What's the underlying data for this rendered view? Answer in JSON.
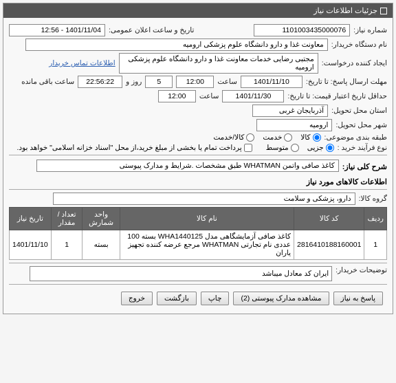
{
  "panel": {
    "title": "جزئیات اطلاعات نیاز"
  },
  "fields": {
    "need_number_label": "شماره نیاز:",
    "need_number": "1101003435000076",
    "announce_label": "تاریخ و ساعت اعلان عمومی:",
    "announce_value": "1401/11/04 - 12:56",
    "buyer_label": "نام دستگاه خریدار:",
    "buyer_value": "معاونت غذا و دارو دانشگاه علوم پزشکی ارومیه",
    "creator_label": "ایجاد کننده درخواست:",
    "creator_value": "مجتبی رضایی خدمات معاونت غذا و دارو دانشگاه علوم پزشکی ارومیه",
    "contact_link": "اطلاعات تماس خریدار",
    "deadline_label": "مهلت ارسال پاسخ: تا تاریخ:",
    "deadline_date": "1401/11/10",
    "hour_label": "ساعت",
    "deadline_time": "12:00",
    "day_label": "روز و",
    "remaining_days": "5",
    "remaining_time": "22:56:22",
    "remaining_suffix": "ساعت باقی مانده",
    "validity_label": "حداقل تاریخ اعتبار قیمت: تا تاریخ:",
    "validity_date": "1401/11/30",
    "validity_time": "12:00",
    "province_label": "استان محل تحویل:",
    "province_value": "آذربایجان غربی",
    "city_label": "شهر محل تحویل:",
    "city_value": "ارومیه",
    "category_label": "طبقه بندی موضوعی:",
    "goods_label": "کالا",
    "service_label": "خدمت",
    "goods_service_label": "کالا/خدمت",
    "purchase_type_label": "نوع فرآیند خرید :",
    "minor": "جزیی",
    "medium": "متوسط",
    "payment_cb_label": "پرداخت تمام یا بخشی از مبلغ خرید،از محل \"اسناد خزانه اسلامی\" خواهد بود.",
    "need_desc_label": "شرح کلی نیاز:",
    "need_desc_value": "کاغذ صافی واتمن WHATMAN  طبق مشخصات .شرایط و مدارک پیوستی",
    "items_title": "اطلاعات کالاهای مورد نیاز",
    "group_label": "گروه کالا:",
    "group_value": "دارو، پزشکی و سلامت",
    "buyer_notes_label": "توضیحات خریدار:",
    "buyer_notes_value": "ایران کد معادل میباشد"
  },
  "table": {
    "headers": {
      "row": "ردیف",
      "code": "کد کالا",
      "name": "نام کالا",
      "unit": "واحد شمارش",
      "qty": "تعداد / مقدار",
      "date": "تاریخ نیاز"
    },
    "rows": [
      {
        "row": "1",
        "code": "2816410188160001",
        "name": "کاغذ صافی آزمایشگاهی مدل WHA1440125 بسته 100 عددی نام تجارتی WHATMAN مرجع عرضه کننده تجهیز یاران",
        "unit": "بسته",
        "qty": "1",
        "date": "1401/11/10"
      }
    ]
  },
  "buttons": {
    "respond": "پاسخ به نیاز",
    "attachments": "مشاهده مدارک پیوستی (2)",
    "print": "چاپ",
    "back": "بازگشت",
    "exit": "خروج"
  }
}
